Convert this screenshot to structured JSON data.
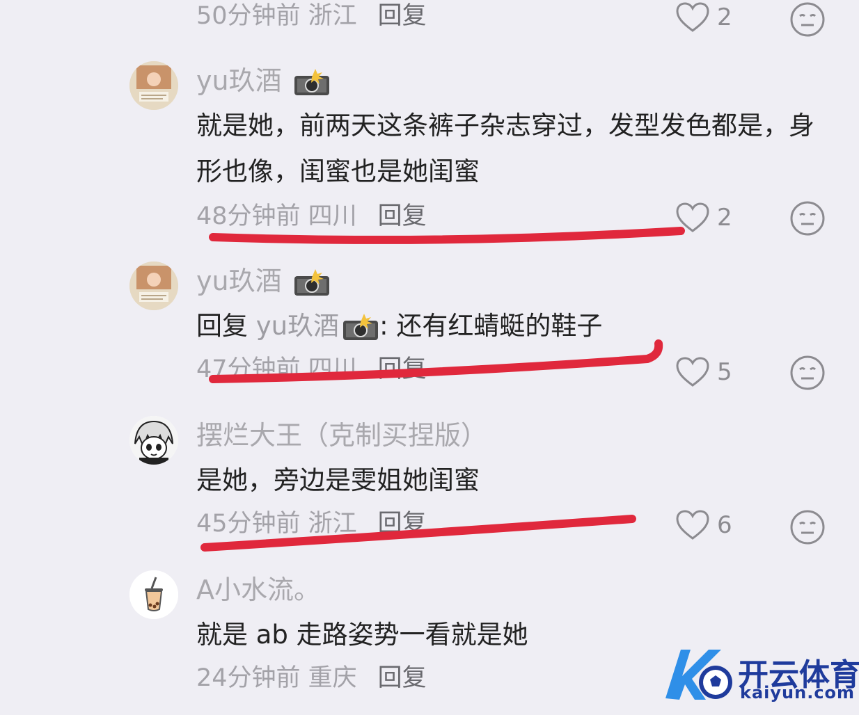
{
  "comments": [
    {
      "meta": "50分钟前 浙江",
      "reply_label": "回复",
      "likes": "2"
    },
    {
      "username": "yu玖酒",
      "content": "就是她，前两天这条裤子杂志穿过，发型发色都是，身形也像，闺蜜也是她闺蜜",
      "meta": "48分钟前 四川",
      "reply_label": "回复",
      "likes": "2"
    },
    {
      "username": "yu玖酒",
      "reply_prefix": "回复",
      "reply_to": "yu玖酒",
      "content": ": 还有红蜻蜓的鞋子",
      "meta": "47分钟前 四川",
      "reply_label": "回复",
      "likes": "5"
    },
    {
      "username": "摆烂大王（克制买捏版）",
      "content": "是她，旁边是雯姐她闺蜜",
      "meta": "45分钟前 浙江",
      "reply_label": "回复",
      "likes": "6"
    },
    {
      "username": "A小水流。",
      "content": "就是 ab 走路姿势一看就是她",
      "meta": "24分钟前 重庆",
      "reply_label": "回复"
    }
  ],
  "watermark": {
    "cn": "开云体育",
    "en": "kaiyun.com"
  },
  "colors": {
    "background": "#efeef4",
    "annotation_red": "#e0283c",
    "watermark_blue": "#1f3b9c"
  }
}
